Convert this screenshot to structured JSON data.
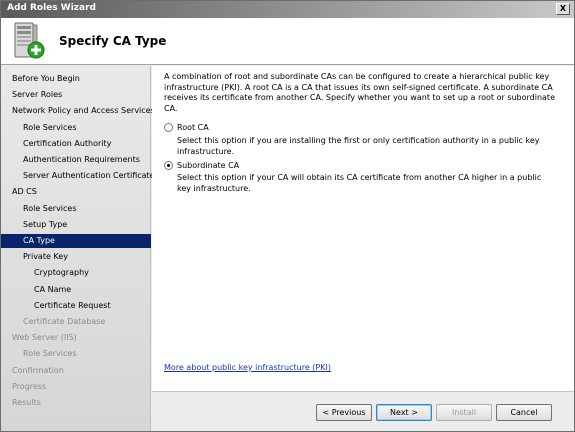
{
  "window": {
    "title": "Add Roles Wizard",
    "close_glyph": "X"
  },
  "banner": {
    "title": "Specify CA Type",
    "icon": "server-add-role-icon"
  },
  "nav": {
    "items": [
      {
        "label": "Before You Begin",
        "state": "normal",
        "level": 0
      },
      {
        "label": "Server Roles",
        "state": "normal",
        "level": 0
      },
      {
        "label": "Network Policy and Access Services",
        "state": "normal",
        "level": 0
      },
      {
        "label": "Role Services",
        "state": "normal",
        "level": 1
      },
      {
        "label": "Certification Authority",
        "state": "normal",
        "level": 1
      },
      {
        "label": "Authentication Requirements",
        "state": "normal",
        "level": 1
      },
      {
        "label": "Server Authentication Certificate",
        "state": "normal",
        "level": 1
      },
      {
        "label": "AD CS",
        "state": "normal",
        "level": 0
      },
      {
        "label": "Role Services",
        "state": "normal",
        "level": 1
      },
      {
        "label": "Setup Type",
        "state": "normal",
        "level": 1
      },
      {
        "label": "CA Type",
        "state": "selected",
        "level": 1
      },
      {
        "label": "Private Key",
        "state": "normal",
        "level": 1
      },
      {
        "label": "Cryptography",
        "state": "normal",
        "level": 2
      },
      {
        "label": "CA Name",
        "state": "normal",
        "level": 2
      },
      {
        "label": "Certificate Request",
        "state": "normal",
        "level": 2
      },
      {
        "label": "Certificate Database",
        "state": "disabled",
        "level": 1
      },
      {
        "label": "Web Server (IIS)",
        "state": "disabled",
        "level": 0
      },
      {
        "label": "Role Services",
        "state": "disabled",
        "level": 1
      },
      {
        "label": "Confirmation",
        "state": "disabled",
        "level": 0
      },
      {
        "label": "Progress",
        "state": "disabled",
        "level": 0
      },
      {
        "label": "Results",
        "state": "disabled",
        "level": 0
      }
    ]
  },
  "content": {
    "intro": "A combination of root and subordinate CAs can be configured to create a hierarchical public key infrastructure (PKI). A root CA is a CA that issues its own self-signed certificate. A subordinate CA receives its certificate from another CA. Specify whether you want to set up a root or subordinate CA.",
    "options": [
      {
        "label": "Root CA",
        "description": "Select this option if you are installing the first or only certification authority in a public key infrastructure.",
        "checked": false
      },
      {
        "label": "Subordinate CA",
        "description": "Select this option if your CA will obtain its CA certificate from another CA higher in a public key infrastructure.",
        "checked": true
      }
    ],
    "link": "More about public key infrastructure (PKI)"
  },
  "footer": {
    "previous": "< Previous",
    "next": "Next >",
    "install": "Install",
    "cancel": "Cancel"
  },
  "colors": {
    "selection": "#0a246a",
    "link": "#1a33b8"
  }
}
